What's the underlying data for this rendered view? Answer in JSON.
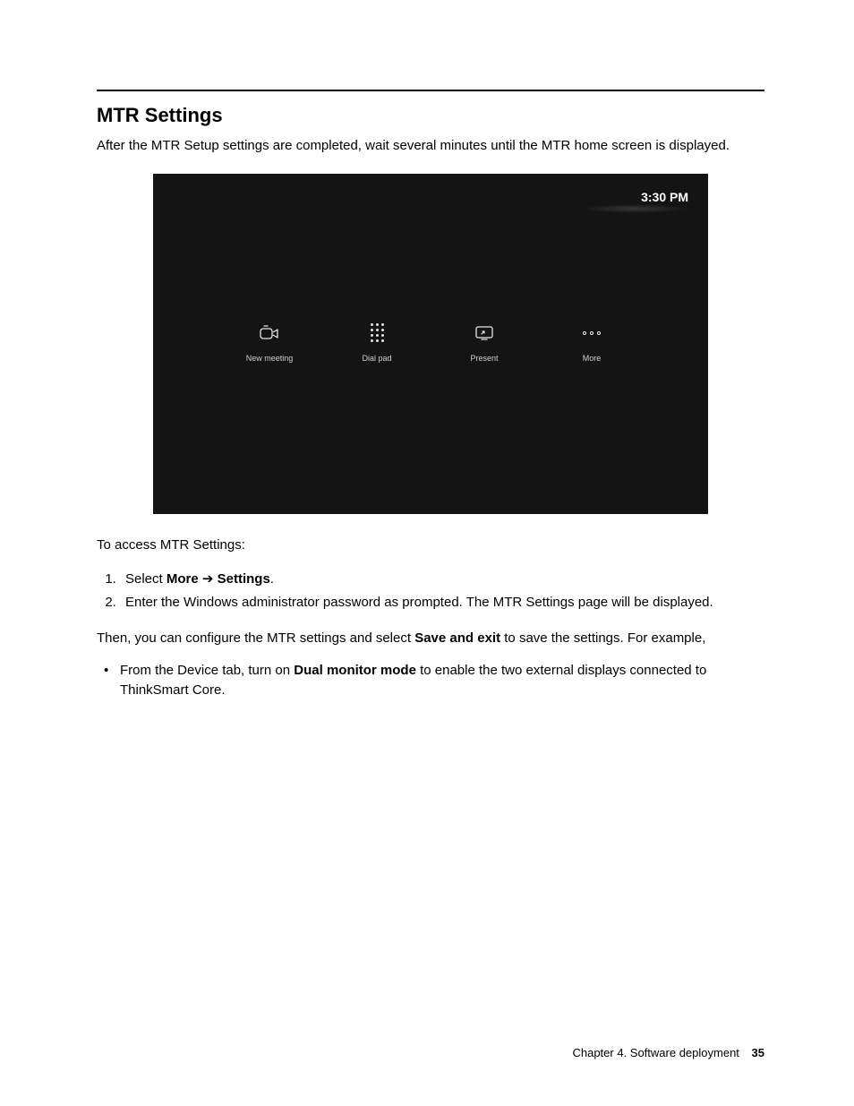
{
  "section_title": "MTR Settings",
  "intro": "After the MTR Setup settings are completed, wait several minutes until the MTR home screen is displayed.",
  "screenshot": {
    "clock": "3:30 PM",
    "actions": {
      "new_meeting": "New meeting",
      "dial_pad": "Dial pad",
      "present": "Present",
      "more": "More"
    }
  },
  "access_intro": "To access MTR Settings:",
  "steps": {
    "s1_a": "Select ",
    "s1_b": "More",
    "s1_arrow": " ➔ ",
    "s1_c": "Settings",
    "s1_d": ".",
    "s2": "Enter the Windows administrator password as prompted. The MTR Settings page will be displayed."
  },
  "then_line": {
    "a": "Then, you can configure the MTR settings and select ",
    "b": "Save and exit",
    "c": " to save the settings. For example,"
  },
  "bullet1": {
    "a": "From the Device tab, turn on ",
    "b": "Dual monitor mode",
    "c": " to enable the two external displays connected to ThinkSmart Core."
  },
  "footer": {
    "chapter": "Chapter 4. Software deployment",
    "page": "35"
  }
}
